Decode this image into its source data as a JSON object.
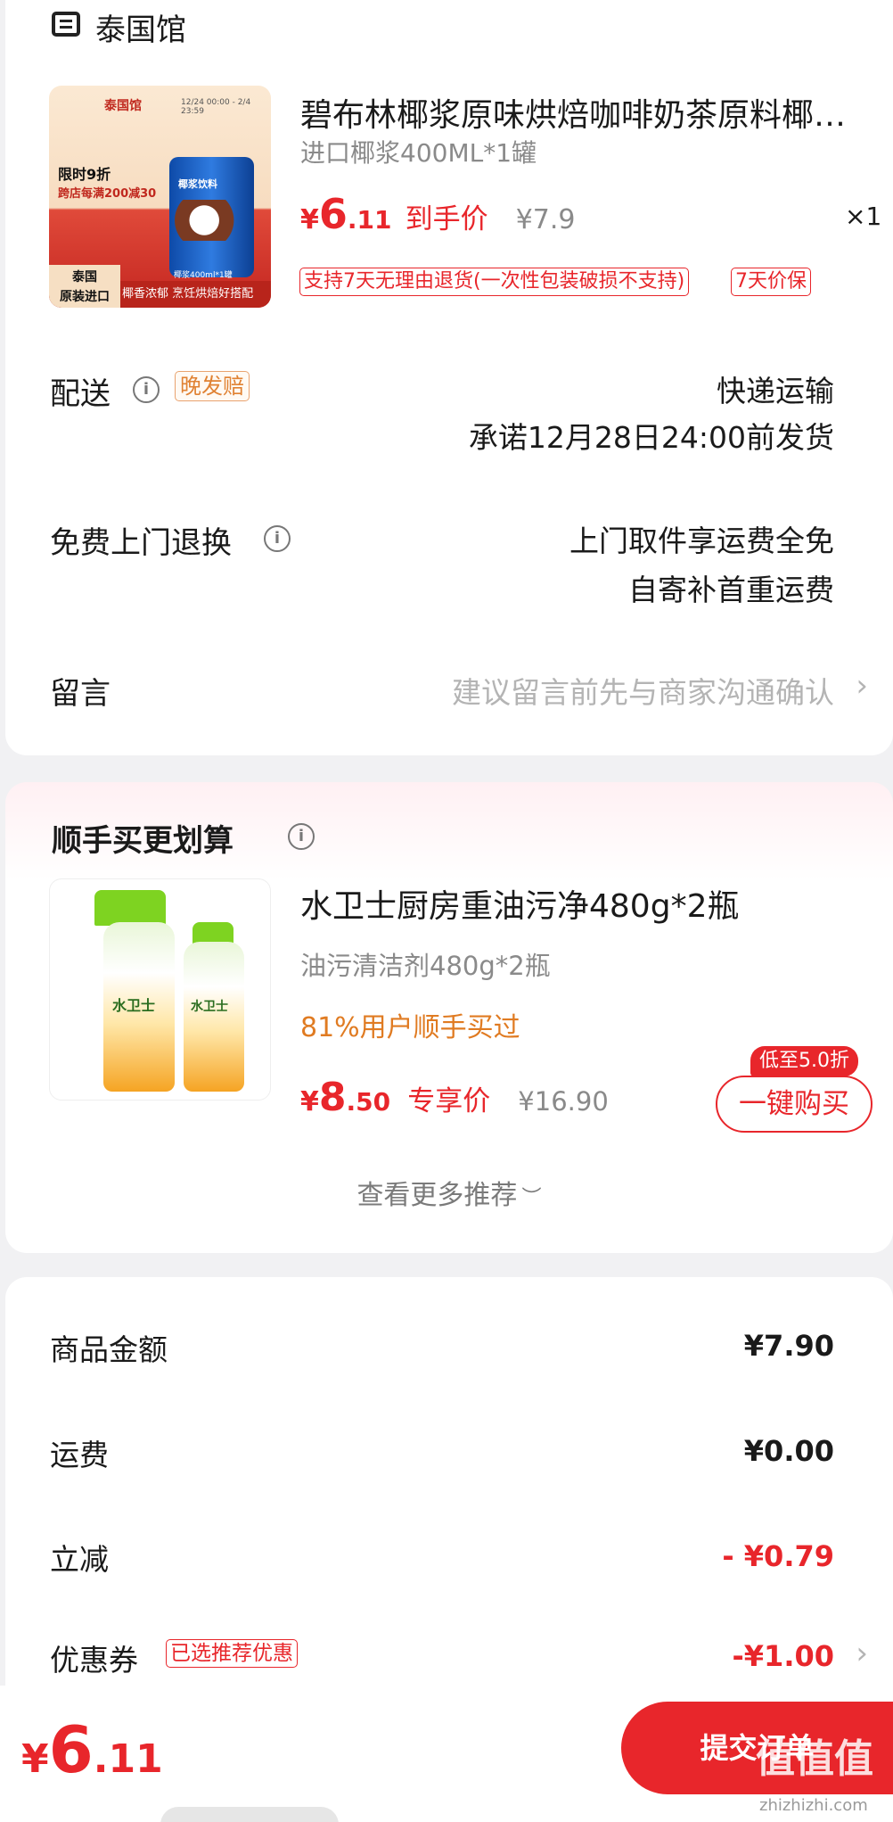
{
  "store": {
    "icon": "store-icon",
    "name": "泰国馆"
  },
  "product1": {
    "title": "碧布林椰浆原味烘焙咖啡奶茶原料椰…",
    "spec": "进口椰浆400ML*1罐",
    "price_symbol": "¥",
    "price_int": "6",
    "price_dec": ".11",
    "price_label": "到手价",
    "orig_price": "¥7.9",
    "quantity": "×1",
    "tags": [
      "支持7天无理由退货(一次性包装破损不支持)",
      "7天价保"
    ],
    "thumb": {
      "store_badge": "泰国馆",
      "date_range": "12/24 00:00 - 2/4 23:59",
      "promo_line1": "限时9折",
      "promo_line2": "跨店每满200减30",
      "can_text": "椰浆饮料",
      "origin_line1": "泰国",
      "origin_line2": "原装进口",
      "bottom_text": "椰香浓郁 烹饪烘焙好搭配",
      "size_text": "椰浆400ml*1罐"
    }
  },
  "delivery": {
    "label": "配送",
    "badge": "晚发赔",
    "method": "快递运输",
    "promise": "承诺12月28日24:00前发货"
  },
  "returns": {
    "label": "免费上门退换",
    "line1": "上门取件享运费全免",
    "line2": "自寄补首重运费"
  },
  "message": {
    "label": "留言",
    "placeholder": "建议留言前先与商家沟通确认"
  },
  "recommend": {
    "title": "顺手买更划算",
    "product": {
      "title": "水卫士厨房重油污净480g*2瓶",
      "spec": "油污清洁剂480g*2瓶",
      "hint": "81%用户顺手买过",
      "price_symbol": "¥",
      "price_int": "8",
      "price_dec": ".50",
      "price_label": "专享价",
      "orig_price": "¥16.90",
      "promo_badge": "低至5.0折",
      "buy_label": "一键购买",
      "brand_text": "水卫士",
      "brand_text_2": "水卫士"
    },
    "more": "查看更多推荐"
  },
  "summary": {
    "rows": [
      {
        "label": "商品金额",
        "value": "¥7.90"
      },
      {
        "label": "运费",
        "value": "¥0.00"
      },
      {
        "label": "立减",
        "value": "- ¥0.79"
      },
      {
        "label": "优惠券",
        "badge": "已选推荐优惠",
        "value": "-¥1.00"
      }
    ]
  },
  "bottom": {
    "total_symbol": "¥",
    "total_int": "6",
    "total_dec": ".11",
    "submit": "提交订单",
    "watermark": "值值值",
    "watermark_url": "zhizhizhi.com"
  },
  "colors": {
    "accent_red": "#e8262b",
    "orange": "#e07b22",
    "gray_text": "#8a8a8a"
  }
}
